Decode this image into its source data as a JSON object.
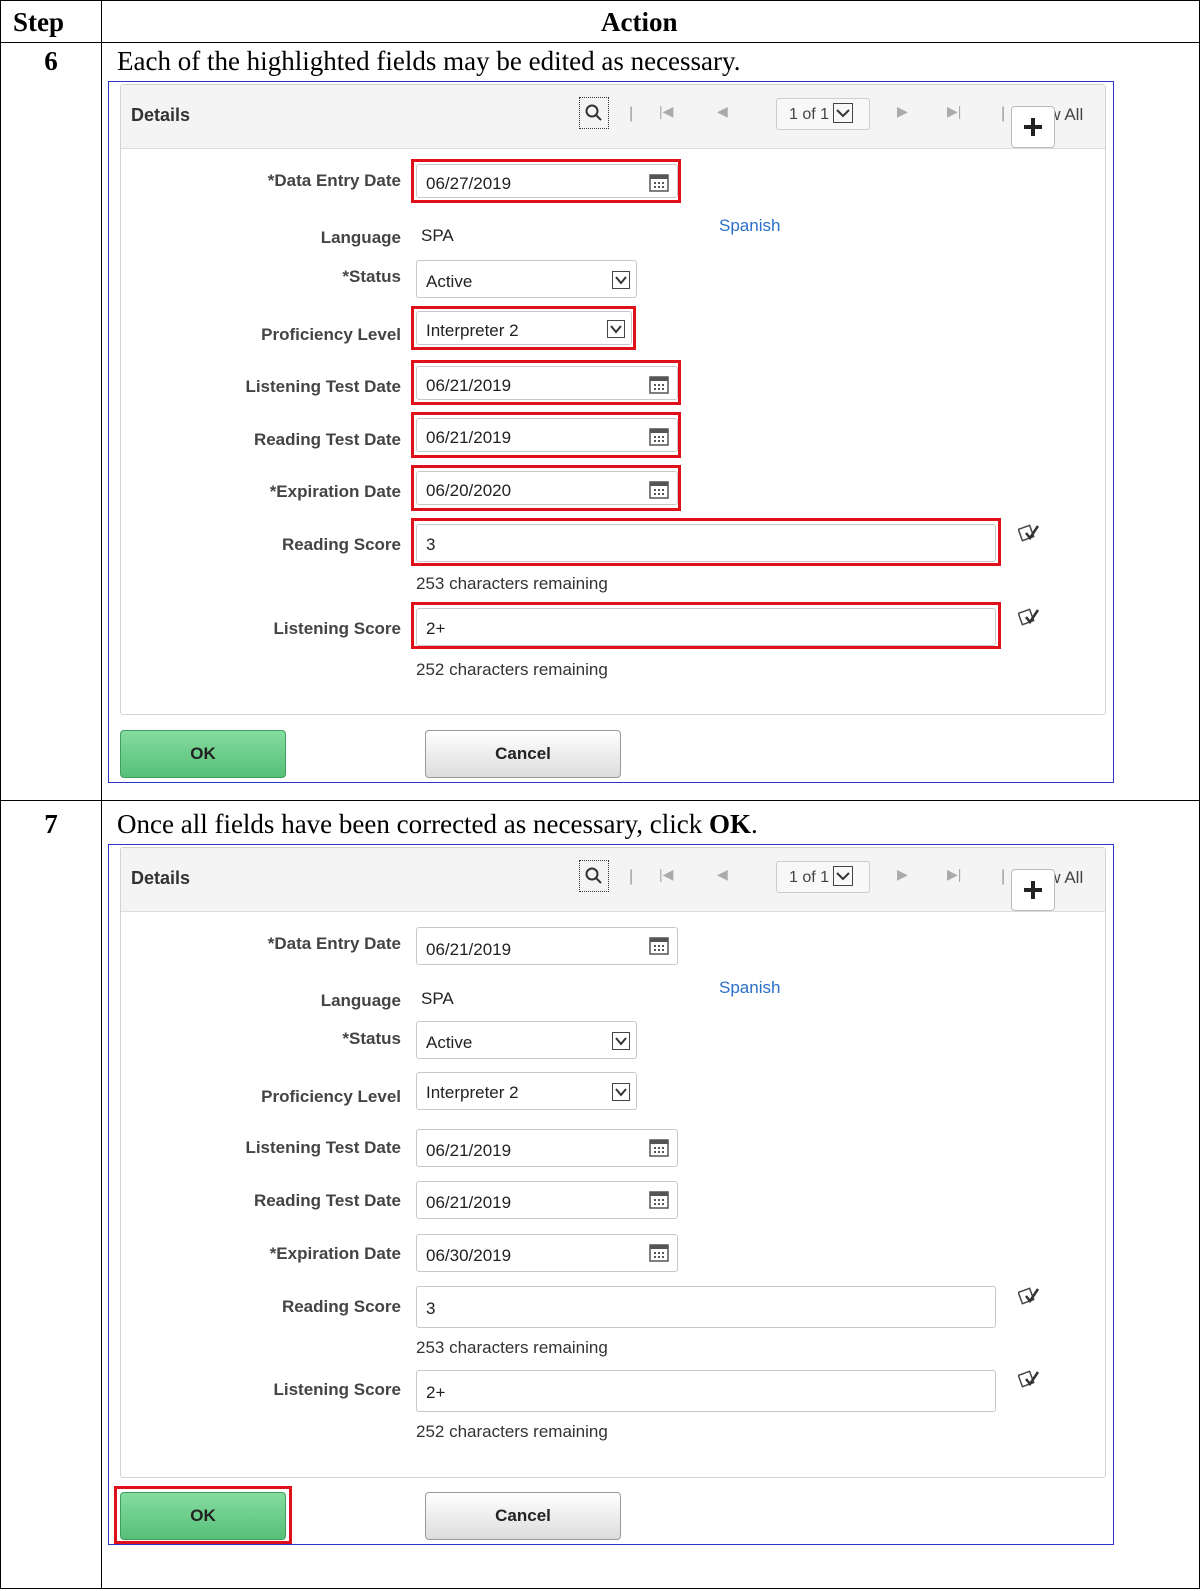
{
  "table": {
    "header_step": "Step",
    "header_action": "Action"
  },
  "steps": [
    {
      "number": "6",
      "instruction": "Each of the highlighted fields may be edited as necessary.",
      "panel": {
        "title": "Details",
        "row_counter": "1 of 1",
        "view_all": "View All",
        "fields": {
          "data_entry_date": {
            "label": "*Data Entry Date",
            "value": "06/27/2019"
          },
          "language": {
            "label": "Language",
            "value": "SPA",
            "description": "Spanish"
          },
          "status": {
            "label": "*Status",
            "value": "Active"
          },
          "proficiency_level": {
            "label": "Proficiency Level",
            "value": "Interpreter 2"
          },
          "listening_test_date": {
            "label": "Listening Test Date",
            "value": "06/21/2019"
          },
          "reading_test_date": {
            "label": "Reading Test Date",
            "value": "06/21/2019"
          },
          "expiration_date": {
            "label": "*Expiration Date",
            "value": "06/20/2020"
          },
          "reading_score": {
            "label": "Reading Score",
            "value": "3",
            "remaining": "253 characters remaining"
          },
          "listening_score": {
            "label": "Listening Score",
            "value": "2+",
            "remaining": "252 characters remaining"
          }
        },
        "ok_label": "OK",
        "cancel_label": "Cancel"
      }
    },
    {
      "number": "7",
      "instruction_prefix": "Once all fields have been corrected as necessary, click ",
      "instruction_bold": "OK",
      "instruction_suffix": ".",
      "panel": {
        "title": "Details",
        "row_counter": "1 of 1",
        "view_all": "View All",
        "fields": {
          "data_entry_date": {
            "label": "*Data Entry Date",
            "value": "06/21/2019"
          },
          "language": {
            "label": "Language",
            "value": "SPA",
            "description": "Spanish"
          },
          "status": {
            "label": "*Status",
            "value": "Active"
          },
          "proficiency_level": {
            "label": "Proficiency Level",
            "value": "Interpreter 2"
          },
          "listening_test_date": {
            "label": "Listening Test Date",
            "value": "06/21/2019"
          },
          "reading_test_date": {
            "label": "Reading Test Date",
            "value": "06/21/2019"
          },
          "expiration_date": {
            "label": "*Expiration Date",
            "value": "06/30/2019"
          },
          "reading_score": {
            "label": "Reading Score",
            "value": "3",
            "remaining": "253 characters remaining"
          },
          "listening_score": {
            "label": "Listening Score",
            "value": "2+",
            "remaining": "252 characters remaining"
          }
        },
        "ok_label": "OK",
        "cancel_label": "Cancel"
      }
    }
  ],
  "icons": {
    "search": "magnifier-icon",
    "calendar": "calendar-icon",
    "dropdown": "chevron-down-icon",
    "add": "plus-icon",
    "spell_check": "spell-check-icon"
  },
  "colors": {
    "highlight": "#e0101a",
    "link": "#2a6fc9",
    "ok_button": "#55c077",
    "panel_border": "#2a34c8"
  }
}
